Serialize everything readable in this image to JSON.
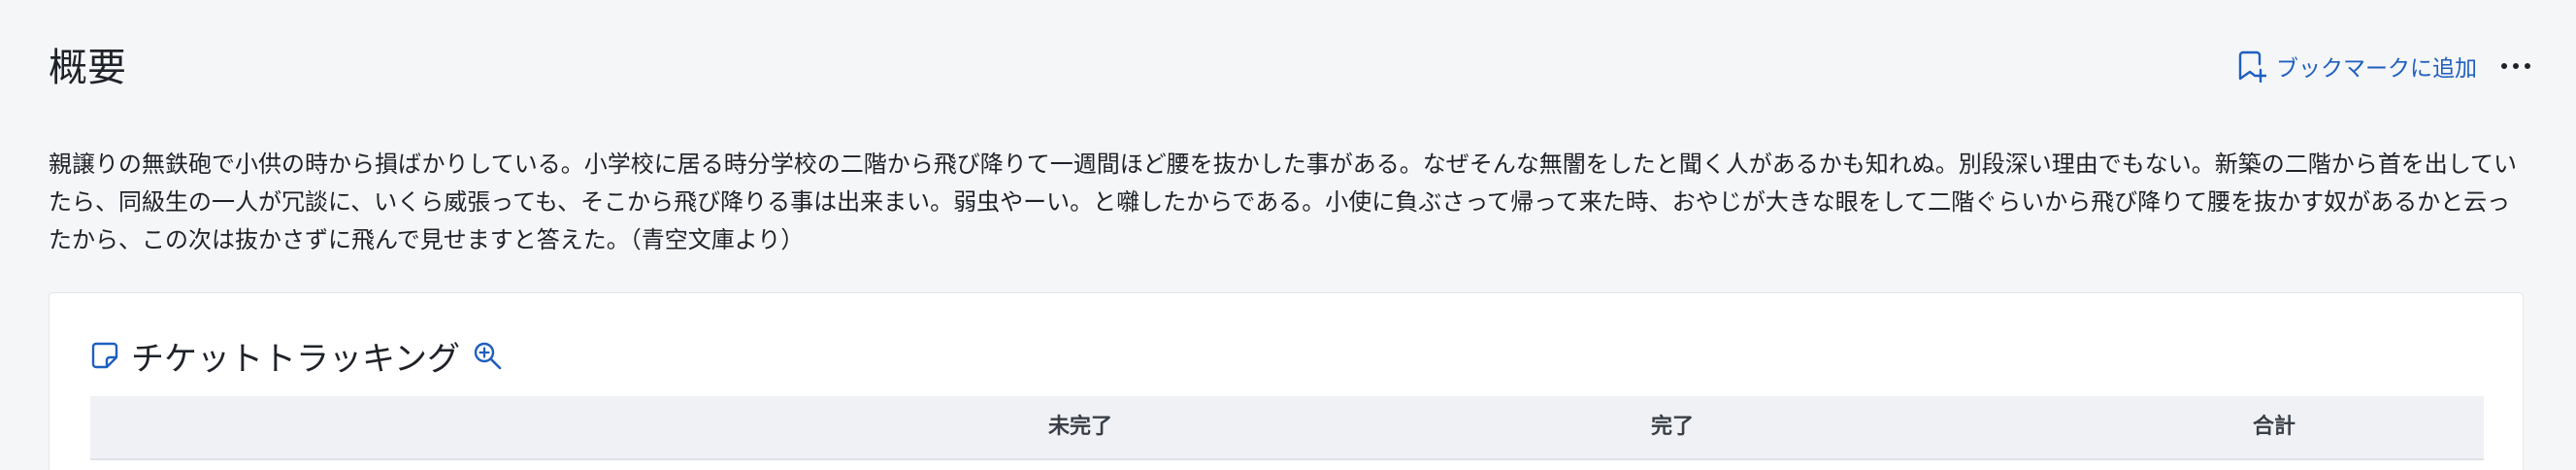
{
  "header": {
    "title": "概要",
    "bookmark_label": "ブックマークに追加",
    "bookmark_icon": "bookmark-add-icon",
    "more_icon": "more-horizontal-icon",
    "accent_color": "#1f5fbf"
  },
  "description": "親譲りの無鉄砲で小供の時から損ばかりしている。小学校に居る時分学校の二階から飛び降りて一週間ほど腰を抜かした事がある。なぜそんな無闇をしたと聞く人があるかも知れぬ。別段深い理由でもない。新築の二階から首を出していたら、同級生の一人が冗談に、いくら威張っても、そこから飛び降りる事は出来まい。弱虫やーい。と囃したからである。小使に負ぶさって帰って来た時、おやじが大きな眼をして二階ぐらいから飛び降りて腰を抜かす奴があるかと云ったから、この次は抜かさずに飛んで見せますと答えた。（青空文庫より）",
  "card": {
    "title": "チケットトラッキング",
    "title_icon": "note-icon",
    "zoom_icon": "zoom-in-icon",
    "table": {
      "columns": [
        "未完了",
        "完了",
        "合計"
      ]
    }
  }
}
